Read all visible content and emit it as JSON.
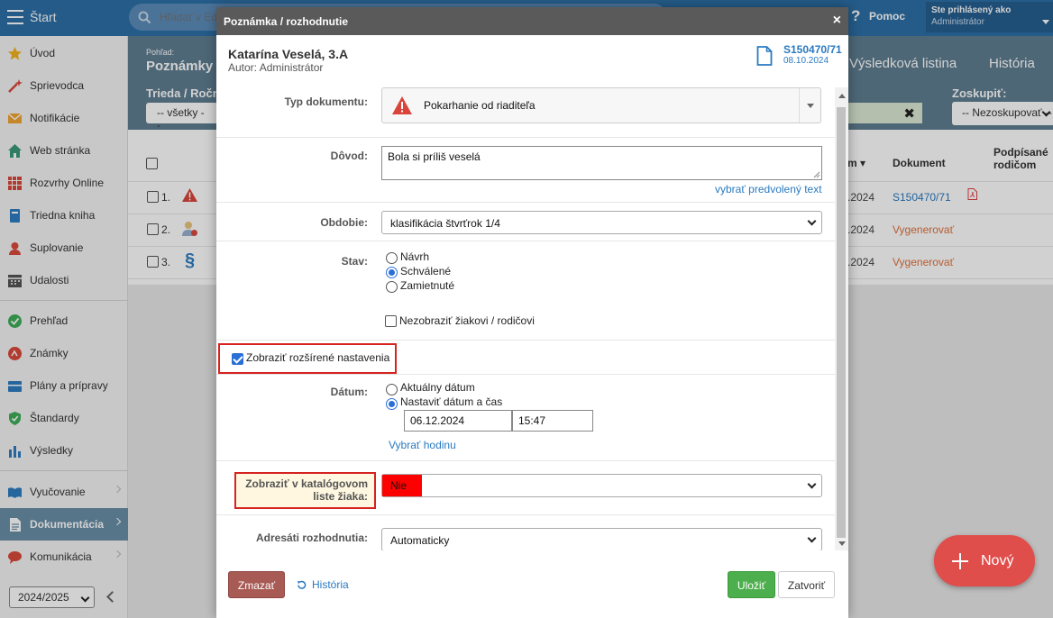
{
  "topbar": {
    "start_label": "Štart",
    "search_placeholder": "Hľadať v Edupage",
    "help_label": "Pomoc",
    "user_line1": "Ste prihlásený ako",
    "user_line2": "Administrátor"
  },
  "sidebar": {
    "items": [
      {
        "label": "Úvod",
        "icon": "star-icon"
      },
      {
        "label": "Sprievodca",
        "icon": "wand-icon"
      },
      {
        "label": "Notifikácie",
        "icon": "envelope-icon"
      },
      {
        "label": "Web stránka",
        "icon": "house-icon"
      },
      {
        "label": "Rozvrhy Online",
        "icon": "timetable-icon"
      },
      {
        "label": "Triedna kniha",
        "icon": "book-icon"
      },
      {
        "label": "Suplovanie",
        "icon": "person-swap-icon"
      },
      {
        "label": "Udalosti",
        "icon": "calendar-icon"
      },
      {
        "label": "Prehľad",
        "icon": "check-circle-icon"
      },
      {
        "label": "Známky",
        "icon": "grades-icon"
      },
      {
        "label": "Plány a prípravy",
        "icon": "plans-icon"
      },
      {
        "label": "Štandardy",
        "icon": "shield-check-icon"
      },
      {
        "label": "Výsledky",
        "icon": "bar-chart-icon"
      },
      {
        "label": "Vyučovanie",
        "icon": "open-book-icon"
      },
      {
        "label": "Dokumentácia",
        "icon": "document-icon"
      },
      {
        "label": "Komunikácia",
        "icon": "chat-icon"
      }
    ],
    "year_value": "2024/2025"
  },
  "main": {
    "view_small": "Pohľad:",
    "view_title": "Poznámky",
    "tab_results": "Výsledková listina",
    "tab_history": "História",
    "filter_label": "Trieda / Ročník",
    "filter_value": "-- všetky --",
    "group_label": "Zoskupiť:",
    "group_value": "-- Nezoskupovať --",
    "col_date_tail": "m",
    "col_document": "Dokument",
    "col_signed_line1": "Podpísané",
    "col_signed_line2": "rodičom",
    "rows": [
      {
        "num": "1.",
        "date": ".2024",
        "doc": "S150470/71",
        "doc_color": "#2a7ac0"
      },
      {
        "num": "2.",
        "date": ".2024",
        "doc": "Vygenerovať",
        "doc_color": "#e0713c"
      },
      {
        "num": "3.",
        "date": ".2024",
        "doc": "Vygenerovať",
        "doc_color": "#e0713c"
      }
    ],
    "new_button": "Nový"
  },
  "modal": {
    "title": "Poznámka / rozhodnutie",
    "close": "×",
    "student": "Katarína Veselá, 3.A",
    "author": "Autor: Administrátor",
    "doc_number": "S150470/71",
    "doc_date": "08.10.2024",
    "typ_label": "Typ dokumentu:",
    "typ_value": "Pokarhanie od riaditeľa",
    "dovod_label": "Dôvod:",
    "dovod_value": "Bola si príliš veselá",
    "dovod_link": "vybrať predvolený text",
    "obdobie_label": "Obdobie:",
    "obdobie_value": "klasifikácia štvrťrok 1/4",
    "stav_label": "Stav:",
    "stav_options": [
      "Návrh",
      "Schválené",
      "Zamietnuté"
    ],
    "stav_selected": "Schválené",
    "hide_label": "Nezobraziť žiakovi / rodičovi",
    "advanced_label": "Zobraziť rozšírené nastavenia",
    "datum_label": "Dátum:",
    "datum_options": [
      "Aktuálny dátum",
      "Nastaviť dátum a čas"
    ],
    "date_value": "06.12.2024",
    "time_value": "15:47",
    "hour_link": "Vybrať hodinu",
    "catalog_label_line1": "Zobraziť v katalógovom",
    "catalog_label_line2": "liste žiaka:",
    "catalog_value": "Nie",
    "catalog_color": "#ff0000",
    "adresati_label": "Adresáti rozhodnutia:",
    "adresati_value": "Automaticky",
    "delete_button": "Zmazať",
    "history_link": "História",
    "save_button": "Uložiť",
    "close_button": "Zatvoriť",
    "colors": {
      "delete": "#a85a55",
      "save": "#4cae4c",
      "link": "#2a7ac0",
      "frame": "#d6231f"
    }
  }
}
